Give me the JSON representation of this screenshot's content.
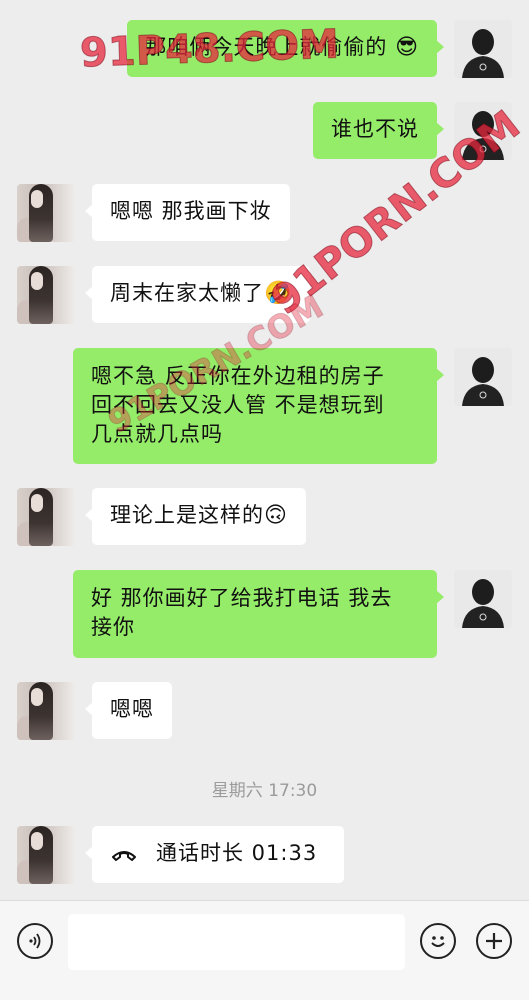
{
  "messages": [
    {
      "from": "me",
      "text": "那咱俩今天晚上就偷偷的",
      "emoji": "😎"
    },
    {
      "from": "me",
      "text": "谁也不说"
    },
    {
      "from": "her",
      "text": "嗯嗯 那我画下妆"
    },
    {
      "from": "her",
      "text": "周末在家太懒了",
      "emoji": "🤣"
    },
    {
      "from": "me",
      "lines": [
        "嗯不急 反正你在外边租的房子",
        "回不回去又没人管 不是想玩到",
        "几点就几点吗"
      ]
    },
    {
      "from": "her",
      "text": "理论上是这样的",
      "emoji": "🙃"
    },
    {
      "from": "me",
      "lines": [
        "好 那你画好了给我打电话 我去",
        "接你"
      ]
    },
    {
      "from": "her",
      "text": "嗯嗯"
    }
  ],
  "timestamp": "星期六 17:30",
  "call": {
    "label": "通话时长 01:33",
    "icon": "phone-hangup-icon"
  },
  "watermarks": [
    "91P48.COM",
    "91PORN.COM",
    "91PORN.COM"
  ],
  "input_bar": {
    "voice_icon": "voice-icon",
    "emoji_icon": "smiley-icon",
    "add_icon": "plus-icon",
    "text_value": ""
  },
  "colors": {
    "my_bubble": "#95ec69",
    "her_bubble": "#ffffff",
    "background": "#ededed",
    "watermark": "#e6283c"
  }
}
